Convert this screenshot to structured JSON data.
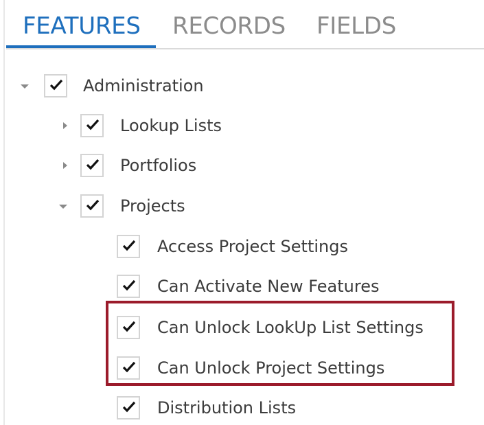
{
  "tabs": [
    {
      "label": "FEATURES",
      "active": true
    },
    {
      "label": "RECORDS",
      "active": false
    },
    {
      "label": "FIELDS",
      "active": false
    }
  ],
  "tree": {
    "administration": {
      "label": "Administration",
      "checked": true,
      "expanded": true
    },
    "lookup_lists": {
      "label": "Lookup Lists",
      "checked": true,
      "expanded": false
    },
    "portfolios": {
      "label": "Portfolios",
      "checked": true,
      "expanded": false
    },
    "projects": {
      "label": "Projects",
      "checked": true,
      "expanded": true
    },
    "project_features": [
      {
        "label": "Access Project Settings",
        "checked": true
      },
      {
        "label": "Can Activate New Features",
        "checked": true
      },
      {
        "label": "Can Unlock LookUp List Settings",
        "checked": true
      },
      {
        "label": "Can Unlock Project Settings",
        "checked": true
      },
      {
        "label": "Distribution Lists",
        "checked": true
      }
    ]
  },
  "colors": {
    "accent": "#1e6fbd",
    "highlight": "#9b1b2b"
  },
  "icons": {
    "check": "checkmark-icon",
    "expanded": "caret-down-icon",
    "collapsed": "caret-right-icon"
  }
}
